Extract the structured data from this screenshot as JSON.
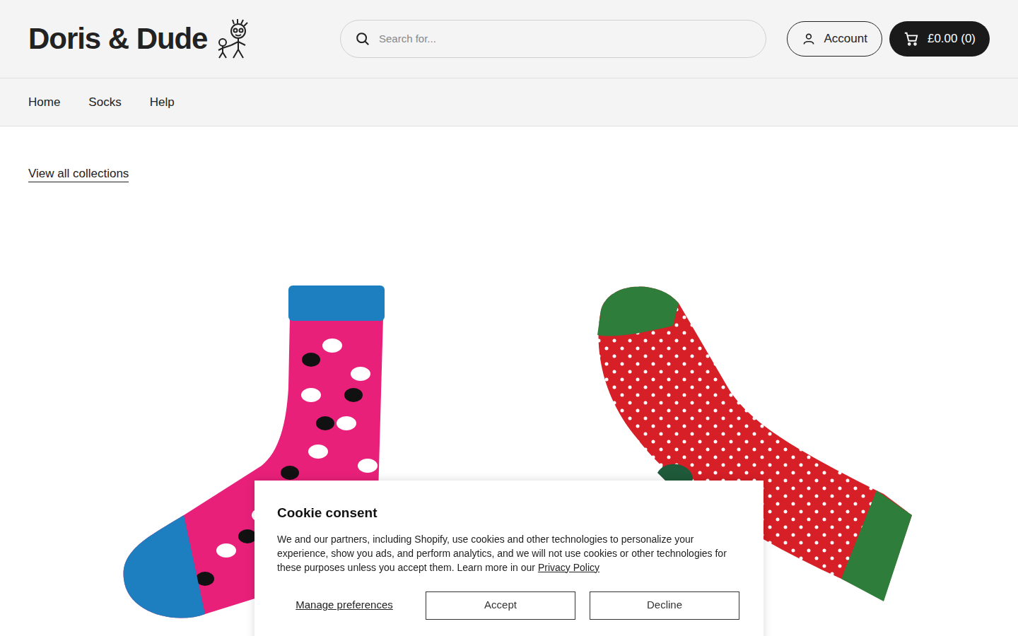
{
  "header": {
    "logo": "Doris & Dude",
    "search": {
      "placeholder": "Search for..."
    },
    "account": "Account",
    "cart": "£0.00 (0)"
  },
  "nav": [
    {
      "label": "Home"
    },
    {
      "label": "Socks"
    },
    {
      "label": "Help"
    }
  ],
  "collection_link": "View all collections",
  "products": [
    {
      "kind": "sheep"
    },
    {
      "kind": "dots"
    }
  ],
  "cookie": {
    "title": "Cookie consent",
    "body": "We and our partners, including Shopify, use cookies and other technologies to personalize your experience, show you ads, and perform analytics, and we will not use cookies or other technologies for these purposes unless you accept them. Learn more in our ",
    "link": "Privacy Policy",
    "manage": "Manage preferences",
    "buttons": [
      "Accept",
      "Decline"
    ]
  }
}
